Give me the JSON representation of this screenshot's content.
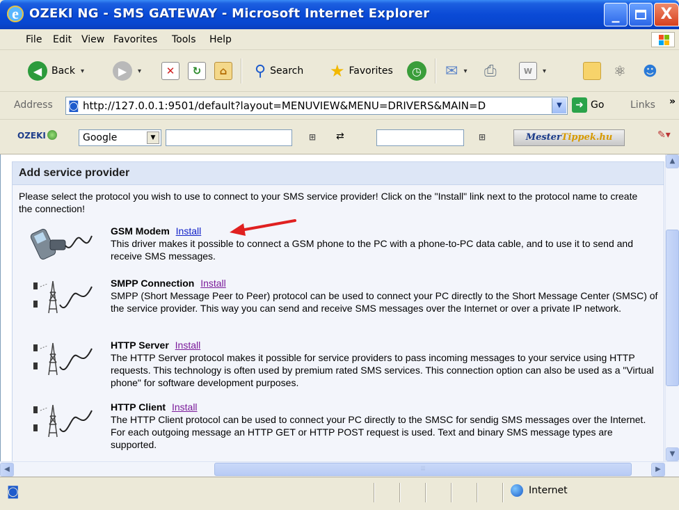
{
  "window": {
    "title": "OZEKI NG - SMS GATEWAY - Microsoft Internet Explorer",
    "title_icon": "e",
    "min_label": "_",
    "close_label": "X"
  },
  "menu": [
    "File",
    "Edit",
    "View",
    "Favorites",
    "Tools",
    "Help"
  ],
  "toolbar": {
    "back_label": "Back",
    "search_label": "Search",
    "favorites_label": "Favorites"
  },
  "address": {
    "label": "Address",
    "url": "http://127.0.0.1:9501/default?layout=MENUVIEW&MENU=DRIVERS&MAIN=D",
    "go_label": "Go",
    "links_label": "Links"
  },
  "googlebar": {
    "brand": "OZEKI",
    "engine": "Google",
    "mester_a": "Mester",
    "mester_b": "Tippek.hu"
  },
  "page": {
    "heading": "Add service provider",
    "intro": "Please select the protocol you wish to use to connect to your SMS service provider! Click on the \"Install\" link next to the protocol name to create the connection!",
    "install_label": "Install",
    "protocols": [
      {
        "name": "GSM Modem",
        "icon": "phone-cable-icon",
        "description": "This driver makes it possible to connect a GSM phone to the PC with a phone-to-PC data cable, and to use it to send and receive SMS messages."
      },
      {
        "name": "SMPP Connection",
        "icon": "antenna-tower-icon",
        "description": "SMPP (Short Message Peer to Peer) protocol can be used to connect your PC directly to the Short Message Center (SMSC) of the service provider. This way you can send and receive SMS messages over the Internet or over a private IP network."
      },
      {
        "name": "HTTP Server",
        "icon": "antenna-tower-icon",
        "description": "The HTTP Server protocol makes it possible for service providers to pass incoming messages to your service using HTTP requests. This technology is often used by premium rated SMS services. This connection option can also be used as a \"Virtual phone\" for software development purposes."
      },
      {
        "name": "HTTP Client",
        "icon": "antenna-tower-icon",
        "description": "The HTTP Client protocol can be used to connect your PC directly to the SMSC for sendig SMS messages over the Internet. For each outgoing message an HTTP GET or HTTP POST request is used. Text and binary SMS message types are supported."
      }
    ]
  },
  "status": {
    "zone": "Internet"
  },
  "colors": {
    "titlebar": "#0a4ad6",
    "chrome": "#ece9d8",
    "panel_header": "#dde6f6",
    "visited_link": "#7a1a9a",
    "link": "#1020c8",
    "arrow": "#e02020"
  }
}
